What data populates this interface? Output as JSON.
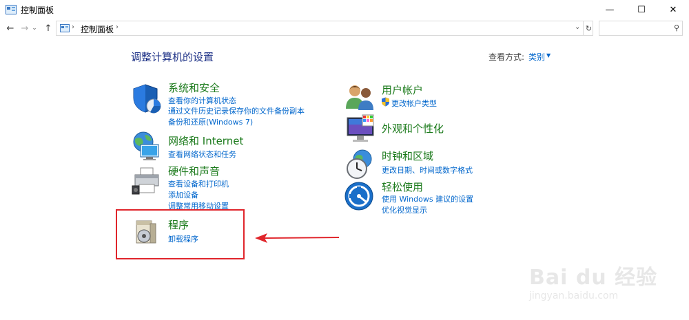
{
  "window": {
    "title": "控制面板",
    "minimize": "—",
    "maximize": "☐",
    "close": "✕"
  },
  "nav": {
    "back": "←",
    "forward": "→",
    "recent": "⌄",
    "up": "↑",
    "breadcrumb": "控制面板",
    "dropdown": "⌄",
    "refresh": "↻",
    "search_placeholder": "",
    "search_icon": "⚲"
  },
  "main": {
    "heading": "调整计算机的设置",
    "view_by_label": "查看方式:",
    "view_by_value": "类别"
  },
  "categories": [
    {
      "title": "系统和安全",
      "icon": "shield-icon",
      "links": [
        "查看你的计算机状态",
        "通过文件历史记录保存你的文件备份副本",
        "备份和还原(Windows 7)"
      ]
    },
    {
      "title": "网络和 Internet",
      "icon": "network-icon",
      "links": [
        "查看网络状态和任务"
      ]
    },
    {
      "title": "硬件和声音",
      "icon": "printer-icon",
      "links": [
        "查看设备和打印机",
        "添加设备",
        "调整常用移动设置"
      ]
    },
    {
      "title": "程序",
      "icon": "programs-icon",
      "links": [
        "卸载程序"
      ]
    },
    {
      "title": "用户帐户",
      "icon": "users-icon",
      "links": [
        "更改帐户类型"
      ]
    },
    {
      "title": "外观和个性化",
      "icon": "monitor-icon",
      "links": []
    },
    {
      "title": "时钟和区域",
      "icon": "clock-icon",
      "links": [
        "更改日期、时间或数字格式"
      ]
    },
    {
      "title": "轻松使用",
      "icon": "accessibility-icon",
      "links": [
        "使用 Windows 建议的设置",
        "优化视觉显示"
      ]
    }
  ],
  "watermark": {
    "main": "Bai du 经验",
    "sub": "jingyan.baidu.com"
  },
  "colors": {
    "heading": "#1e3287",
    "category_title": "#1b7a1b",
    "link": "#0066cc",
    "highlight": "#e0252b"
  }
}
